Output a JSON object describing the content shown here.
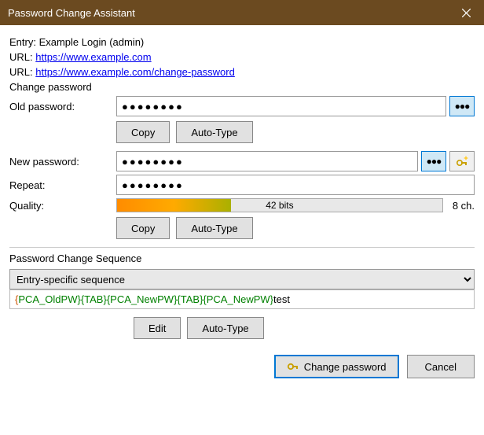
{
  "titlebar": {
    "title": "Password Change Assistant"
  },
  "entry": {
    "prefix": "Entry: ",
    "value": "Example Login (admin)"
  },
  "url1": {
    "prefix": "URL: ",
    "href": "https://www.example.com"
  },
  "url2": {
    "prefix": "URL: ",
    "href": "https://www.example.com/change-password"
  },
  "change_password_label": "Change password",
  "old_password": {
    "label": "Old password:",
    "value": "●●●●●●●●"
  },
  "new_password": {
    "label": "New password:",
    "value": "●●●●●●●●"
  },
  "repeat": {
    "label": "Repeat:",
    "value": "●●●●●●●●"
  },
  "quality": {
    "label": "Quality:",
    "bits": "42 bits",
    "chars": "8 ch."
  },
  "buttons": {
    "copy": "Copy",
    "auto_type": "Auto-Type",
    "edit": "Edit",
    "change_password": "Change password",
    "cancel": "Cancel"
  },
  "dots_icon": "●●●",
  "sequence": {
    "header": "Password Change Sequence",
    "dropdown_value": "Entry-specific sequence",
    "seq_p1_brace_open": "{",
    "seq_p1_rest": "PCA_OldPW}{TAB}{PCA_NewPW}{TAB}{PCA_NewPW}",
    "seq_tail": "test"
  }
}
